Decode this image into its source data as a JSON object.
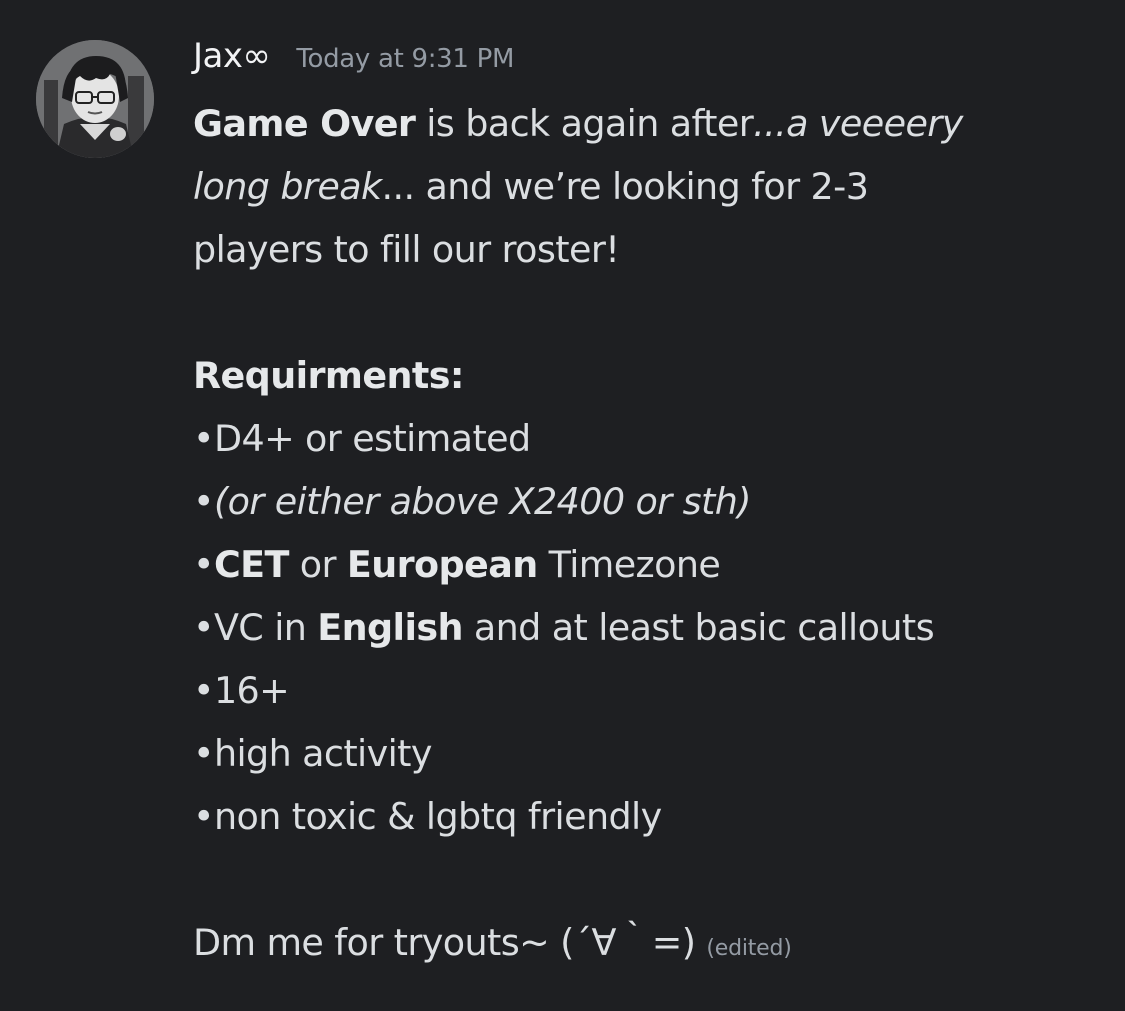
{
  "message": {
    "author": "Jax∞",
    "timestamp": "Today at 9:31 PM",
    "avatar_icon": "user-avatar-icon",
    "intro": {
      "bold_title": "Game Over",
      "text1": " is back again after",
      "italic1": "...a veeeery",
      "italic2": "long break",
      "text2": "... and we’re looking for 2-3",
      "text3": "players to fill our roster!"
    },
    "requirements": {
      "heading": "Requirments:",
      "bullet": "•",
      "item1": "D4+ or estimated",
      "item2": "(or either above X2400 or sth)",
      "item3_bold1": "CET",
      "item3_text1": " or ",
      "item3_bold2": "European",
      "item3_text2": " Timezone",
      "item4_text1": "VC in ",
      "item4_bold": "English",
      "item4_text2": " and at least basic callouts",
      "item5": "16+",
      "item6": "high activity",
      "item7": "non toxic & lgbtq friendly"
    },
    "closing": "Dm me for tryouts~ (´∀｀=) ",
    "edited_label": "(edited)"
  }
}
